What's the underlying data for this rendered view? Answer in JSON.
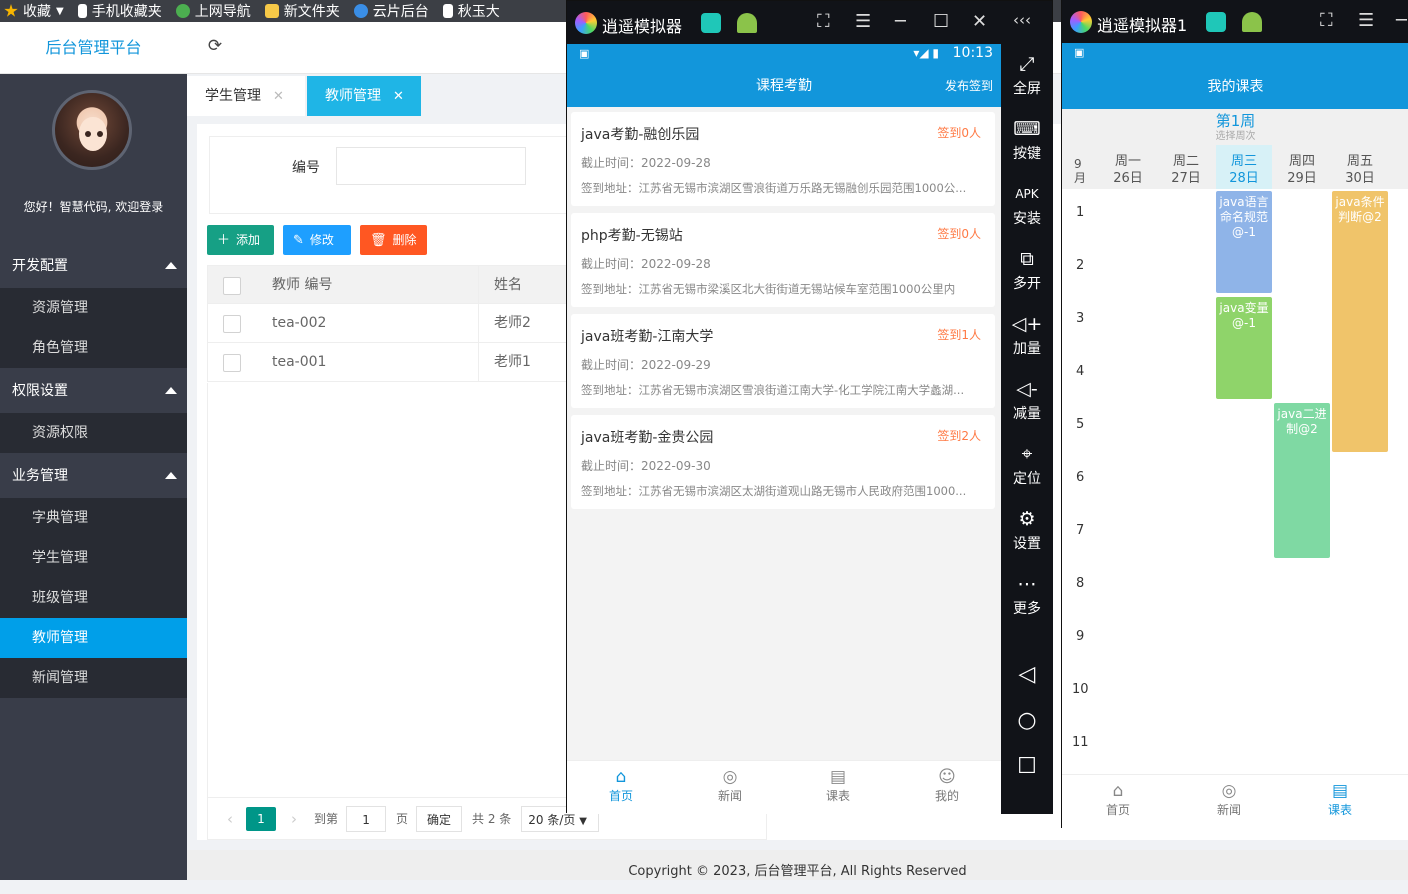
{
  "bookmarks": [
    {
      "label": "收藏",
      "color": "#f7b500"
    },
    {
      "label": "手机收藏夹",
      "color": "#ffffff"
    },
    {
      "label": "上网导航",
      "color": "#4caf50"
    },
    {
      "label": "新文件夹",
      "color": "#f7c948"
    },
    {
      "label": "云片后台",
      "color": "#3a8ee6"
    },
    {
      "label": "秋玉大",
      "color": "#ffffff"
    }
  ],
  "admin": {
    "title": "后台管理平台",
    "welcome": "您好！智慧代码, 欢迎登录",
    "menu": {
      "groups": [
        "开发配置",
        "权限设置",
        "业务管理"
      ],
      "dev_items": [
        "资源管理",
        "角色管理"
      ],
      "perm_items": [
        "资源权限"
      ],
      "biz_items": [
        "字典管理",
        "学生管理",
        "班级管理",
        "教师管理",
        "新闻管理"
      ]
    },
    "tabs": [
      "学生管理",
      "教师管理"
    ],
    "search_label": "编号",
    "buttons": {
      "add": "添加",
      "edit": "修改",
      "delete": "删除"
    },
    "table": {
      "headers": [
        "教师 编号",
        "姓名"
      ],
      "rows": [
        {
          "code": "tea-002",
          "name": "老师2"
        },
        {
          "code": "tea-001",
          "name": "老师1"
        }
      ]
    },
    "pager": {
      "current": "1",
      "goto": "到第",
      "page_input": "1",
      "page_unit": "页",
      "confirm": "确定",
      "total": "共 2 条",
      "size": "20 条/页"
    },
    "footer": "Copyright © 2023, 后台管理平台, All Rights Reserved"
  },
  "emulator1": {
    "title": "逍遥模拟器",
    "time": "10:13",
    "nav_title": "课程考勤",
    "nav_action": "发布签到",
    "cards": [
      {
        "title": "java考勤-融创乐园",
        "status": "签到0人",
        "deadline": "截止时间：2022-09-28",
        "address": "签到地址：江苏省无锡市滨湖区雪浪街道万乐路无锡融创乐园范围1000公..."
      },
      {
        "title": "php考勤-无锡站",
        "status": "签到0人",
        "deadline": "截止时间：2022-09-28",
        "address": "签到地址：江苏省无锡市梁溪区北大街街道无锡站候车室范围1000公里内"
      },
      {
        "title": "java班考勤-江南大学",
        "status": "签到1人",
        "deadline": "截止时间：2022-09-29",
        "address": "签到地址：江苏省无锡市滨湖区雪浪街道江南大学-化工学院江南大学蠡湖..."
      },
      {
        "title": "java班考勤-金贵公园",
        "status": "签到2人",
        "deadline": "截止时间：2022-09-30",
        "address": "签到地址：江苏省无锡市滨湖区太湖街道观山路无锡市人民政府范围1000..."
      }
    ],
    "tabs": [
      "首页",
      "新闻",
      "课表",
      "我的"
    ],
    "tools": [
      "全屏",
      "按键",
      "安装",
      "多开",
      "加量",
      "减量",
      "定位",
      "设置",
      "更多"
    ]
  },
  "emulator2": {
    "title": "逍遥模拟器1",
    "nav_title": "我的课表",
    "week": "第1周",
    "week_hint": "选择周次",
    "month": "9月",
    "days": [
      {
        "name": "周一",
        "date": "26日"
      },
      {
        "name": "周二",
        "date": "27日"
      },
      {
        "name": "周三",
        "date": "28日"
      },
      {
        "name": "周四",
        "date": "29日"
      },
      {
        "name": "周五",
        "date": "30日"
      }
    ],
    "rows": [
      "1",
      "2",
      "3",
      "4",
      "5",
      "6",
      "7",
      "8",
      "9",
      "10",
      "11"
    ],
    "courses": [
      {
        "label": "java语言命名规范@-1",
        "color": "#8fb4e8"
      },
      {
        "label": "java变量@-1",
        "color": "#8fd46a"
      },
      {
        "label": "java二进制@2",
        "color": "#7fd9a3"
      },
      {
        "label": "java条件判断@2",
        "color": "#f0c46a"
      }
    ],
    "tabs": [
      "首页",
      "新闻",
      "课表"
    ]
  }
}
